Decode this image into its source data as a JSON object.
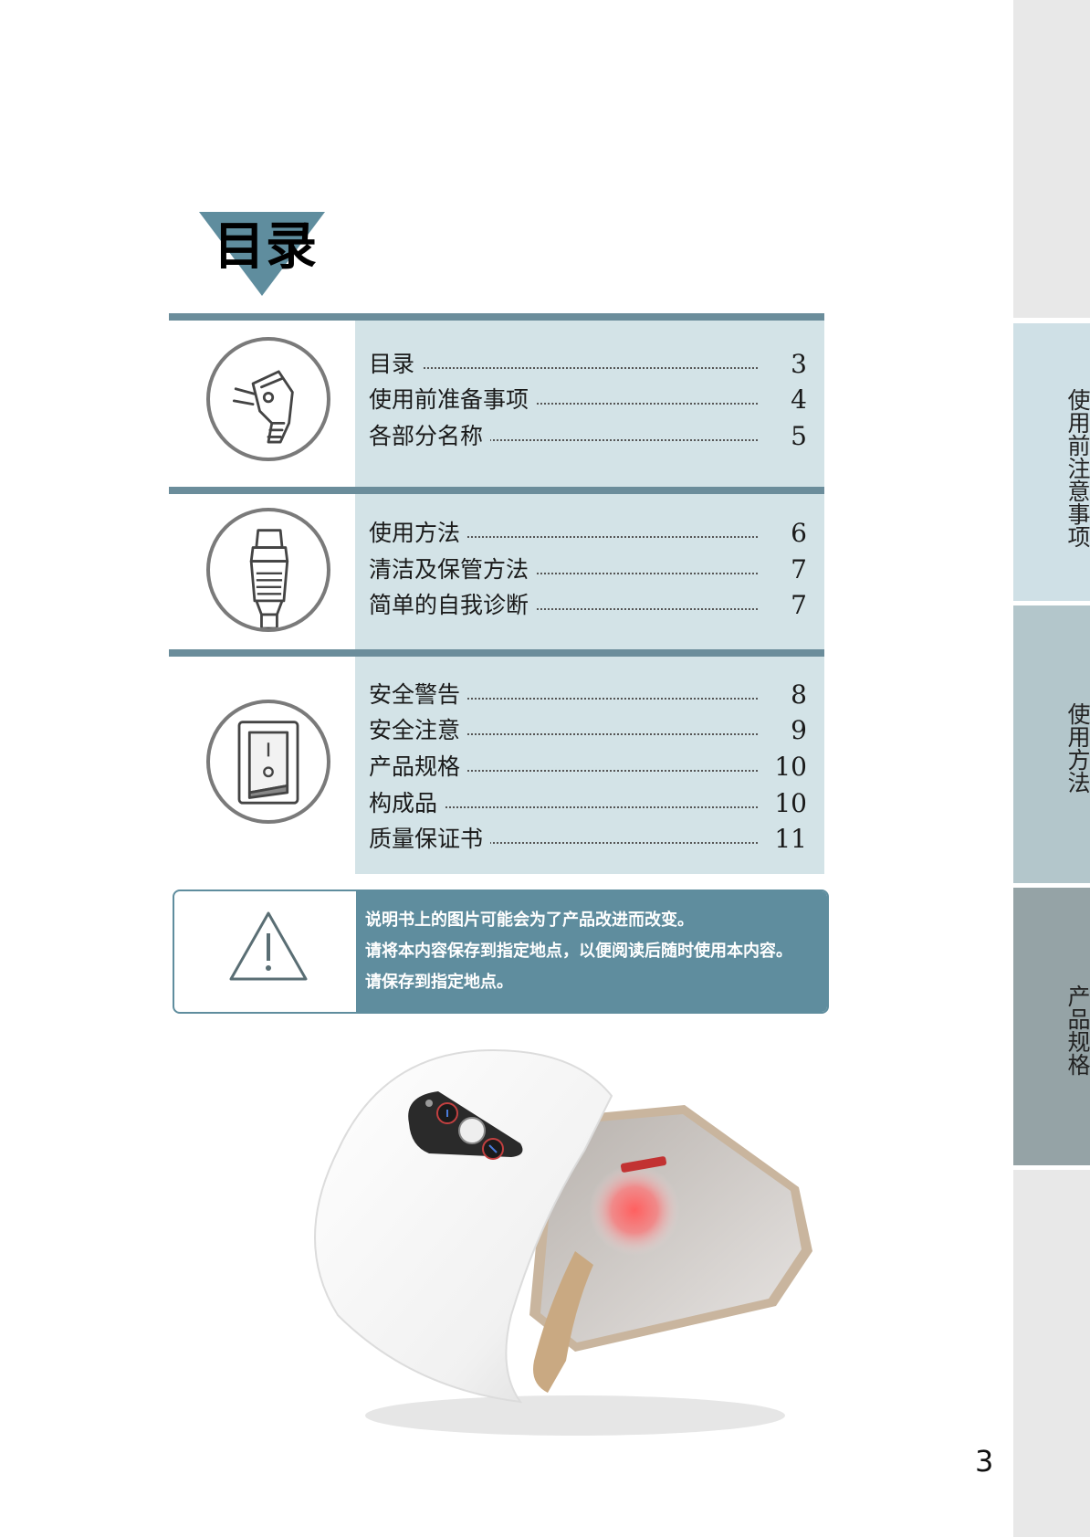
{
  "title": "目录",
  "sections": [
    {
      "icon": "plug-icon",
      "entries": [
        {
          "label": "目录",
          "page": "3"
        },
        {
          "label": "使用前准备事项",
          "page": "4"
        },
        {
          "label": "各部分名称",
          "page": "5"
        }
      ]
    },
    {
      "icon": "connector-icon",
      "entries": [
        {
          "label": "使用方法",
          "page": "6"
        },
        {
          "label": "清洁及保管方法",
          "page": "7"
        },
        {
          "label": "简单的自我诊断",
          "page": "7"
        }
      ]
    },
    {
      "icon": "power-switch-icon",
      "entries": [
        {
          "label": "安全警告",
          "page": "8"
        },
        {
          "label": "安全注意",
          "page": "9"
        },
        {
          "label": "产品规格",
          "page": "10"
        },
        {
          "label": "构成品",
          "page": "10"
        },
        {
          "label": "质量保证书",
          "page": "11"
        }
      ]
    }
  ],
  "notice": {
    "icon": "warning-icon",
    "lines": [
      "说明书上的图片可能会为了产品改进而改变。",
      "请将本内容保存到指定地点，以便阅读后随时使用本内容。",
      "请保存到指定地点。"
    ]
  },
  "side_tabs": [
    "使用前注意事项",
    "使用方法",
    "产品规格"
  ],
  "colors": {
    "accent": "#5f8d9e",
    "section_bg": "#d3e3e7",
    "tab_1": "#cfe0e6",
    "tab_2": "#b3c6cb",
    "tab_3": "#95a3a6",
    "tab_plain": "#e8e8e8"
  },
  "page_number": "3"
}
